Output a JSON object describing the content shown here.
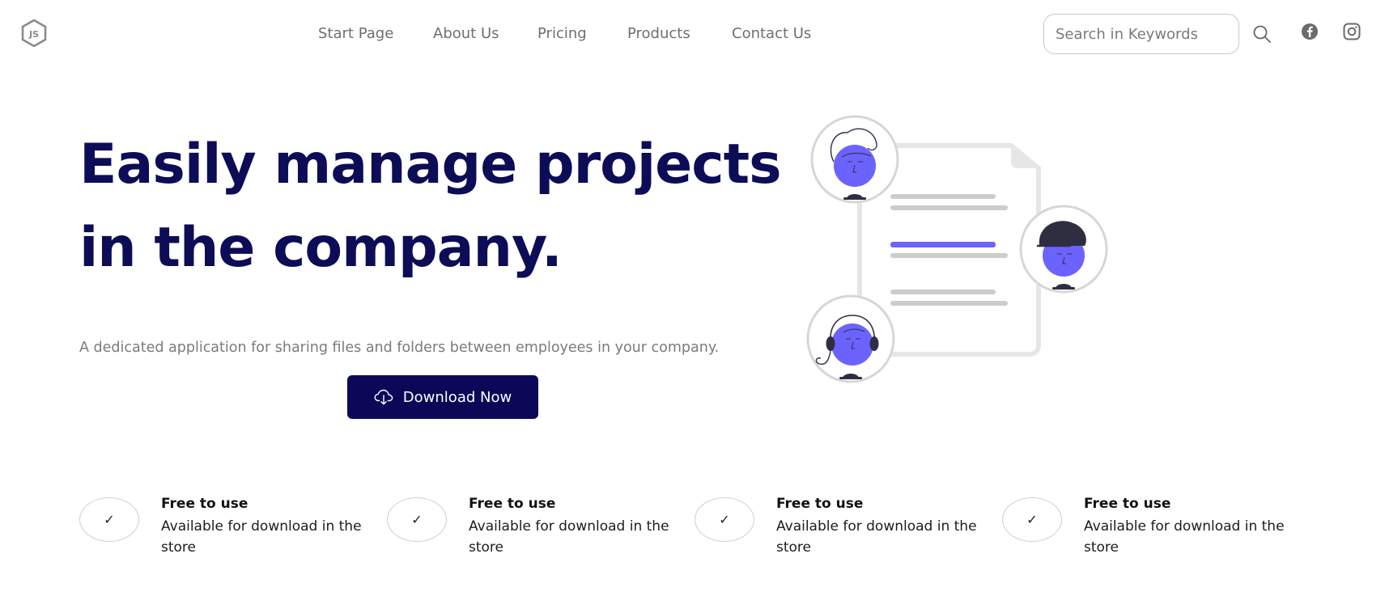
{
  "header": {
    "logo_text": "JS",
    "nav": [
      {
        "label": "Start Page"
      },
      {
        "label": "About Us"
      },
      {
        "label": "Pricing"
      },
      {
        "label": "Products"
      },
      {
        "label": "Contact Us"
      }
    ],
    "search": {
      "placeholder": "Search in Keywords",
      "value": ""
    },
    "icons": [
      "search-icon",
      "facebook-icon",
      "instagram-icon"
    ]
  },
  "hero": {
    "title": "Easily manage projects in the company.",
    "subtitle": "A dedicated application for sharing files and folders between employees in your company.",
    "cta_label": "Download Now",
    "cta_icon": "cloud-download-icon"
  },
  "features": [
    {
      "title": "Free to use",
      "description": "Available for download in the store"
    },
    {
      "title": "Free to use",
      "description": "Available for download in the store"
    },
    {
      "title": "Free to use",
      "description": "Available for download in the store"
    },
    {
      "title": "Free to use",
      "description": "Available for download in the store"
    }
  ],
  "colors": {
    "brand_navy": "#0d0c57",
    "button_navy": "#0b0957",
    "accent_purple": "#6c63ff",
    "muted_text": "#7b7b7b"
  }
}
